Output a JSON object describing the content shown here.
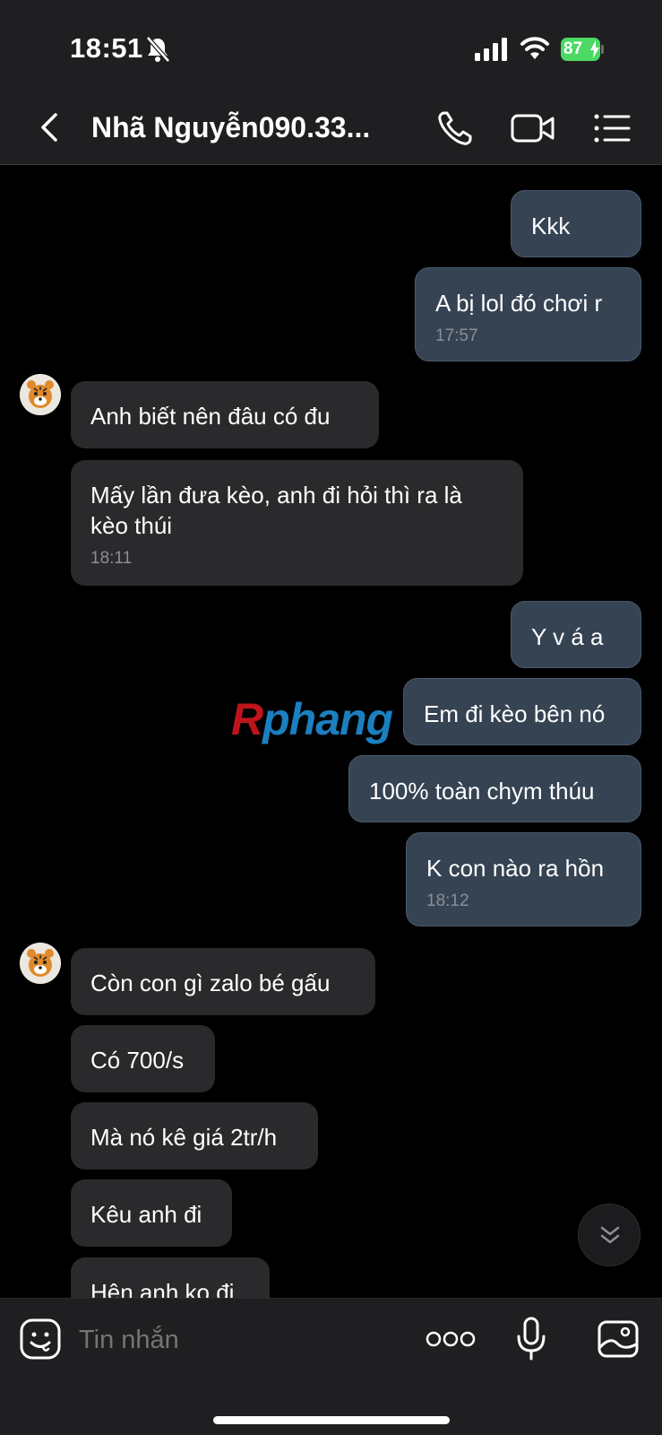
{
  "status_bar": {
    "time": "18:51",
    "battery": "87"
  },
  "header": {
    "contact_name": "Nhã Nguyễn090.33..."
  },
  "messages": [
    {
      "dir": "out",
      "text": "Kkk",
      "time": ""
    },
    {
      "dir": "out",
      "text": "A bị lol đó chơi r",
      "time": "17:57"
    },
    {
      "dir": "in",
      "text": "Anh biết nên đâu có đu",
      "time": ""
    },
    {
      "dir": "in",
      "text": "Mấy lần đưa kèo, anh đi hỏi thì ra là kèo thúi",
      "time": "18:11"
    },
    {
      "dir": "out",
      "text": "Y v á a",
      "time": ""
    },
    {
      "dir": "out",
      "text": "Em đi kèo bên nó",
      "time": ""
    },
    {
      "dir": "out",
      "text": "100% toàn chym thúu",
      "time": ""
    },
    {
      "dir": "out",
      "text": "K con nào ra hồn",
      "time": "18:12"
    },
    {
      "dir": "in",
      "text": "Còn con gì zalo bé gấu",
      "time": ""
    },
    {
      "dir": "in",
      "text": "Có 700/s",
      "time": ""
    },
    {
      "dir": "in",
      "text": "Mà nó kê giá 2tr/h",
      "time": ""
    },
    {
      "dir": "in",
      "text": "Kêu anh đi",
      "time": ""
    },
    {
      "dir": "in",
      "text": "Hên anh ko đi",
      "time": ""
    }
  ],
  "watermark": {
    "first_letter": "R",
    "rest": "phang"
  },
  "composer": {
    "placeholder": "Tin nhắn"
  },
  "colors": {
    "outgoing_bubble": "#354353",
    "incoming_bubble": "#2a2a2c",
    "battery": "#4cd964"
  }
}
